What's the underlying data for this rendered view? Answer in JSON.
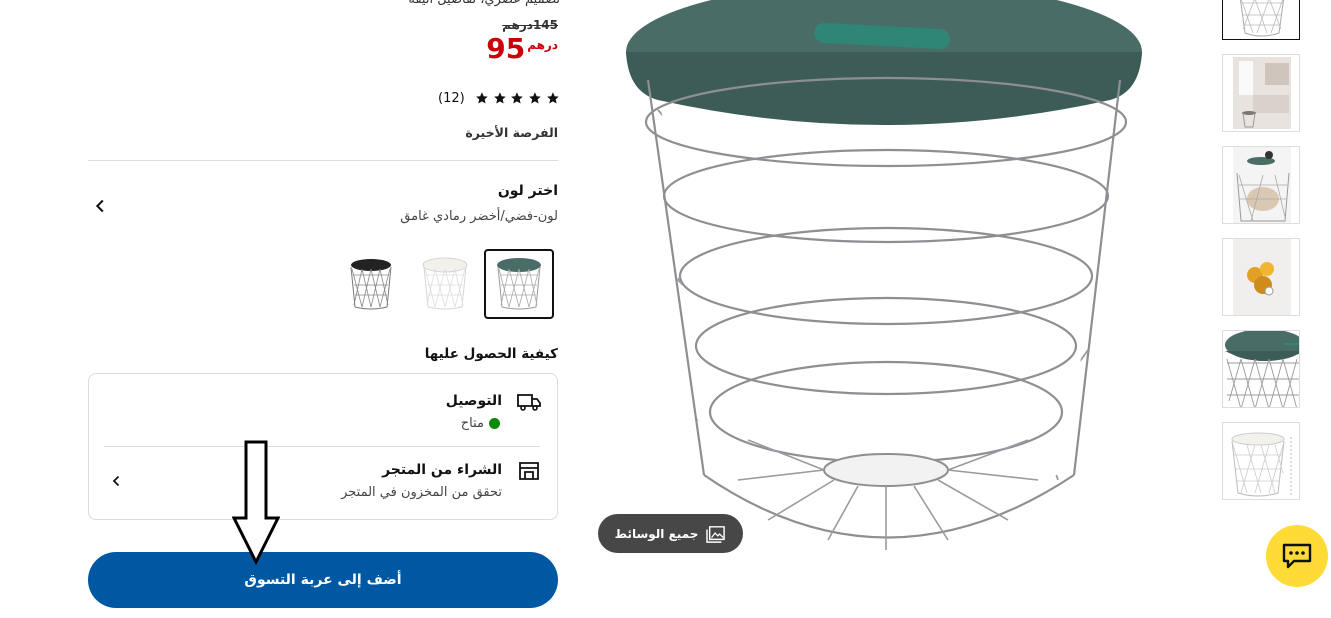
{
  "product": {
    "top_cut_text": "تصميم عصري، تفاصيل أنيقة",
    "old_price": "145درهم",
    "price_number": "95",
    "price_currency": "درهم",
    "rating_count": "(12)",
    "rating_stars": 5,
    "last_chance": "الفرصة الأخيرة"
  },
  "color_selector": {
    "heading": "اختر لون",
    "selected_name": "لون-فضي/أخضر رمادي غامق",
    "swatches": [
      {
        "name": "silver-dark-grey-green",
        "lid_color": "#4a6c66",
        "selected": true
      },
      {
        "name": "white",
        "lid_color": "#f2f1ec",
        "selected": false
      },
      {
        "name": "black",
        "lid_color": "#222222",
        "selected": false
      }
    ]
  },
  "availability": {
    "heading": "كيفية الحصول عليها",
    "delivery_title": "التوصيل",
    "delivery_status": "متاح",
    "delivery_status_color": "#0a8a00",
    "store_title": "الشراء من المتجر",
    "store_sub": "تحقق من المخزون في المتجر"
  },
  "actions": {
    "add_to_cart": "أضف إلى عربة التسوق",
    "all_media": "جميع الوسائط"
  },
  "colors": {
    "primary_blue": "#0058a3",
    "price_red": "#cc0008",
    "chat_yellow": "#fedb37",
    "lid_green": "#4a6c66"
  },
  "thumbnails": [
    {
      "name": "thumb-product-top",
      "selected": true
    },
    {
      "name": "thumb-room-scene",
      "selected": false
    },
    {
      "name": "thumb-with-contents",
      "selected": false
    },
    {
      "name": "thumb-detail-orange",
      "selected": false
    },
    {
      "name": "thumb-lid-closeup",
      "selected": false
    },
    {
      "name": "thumb-white-dimensions",
      "selected": false
    }
  ]
}
